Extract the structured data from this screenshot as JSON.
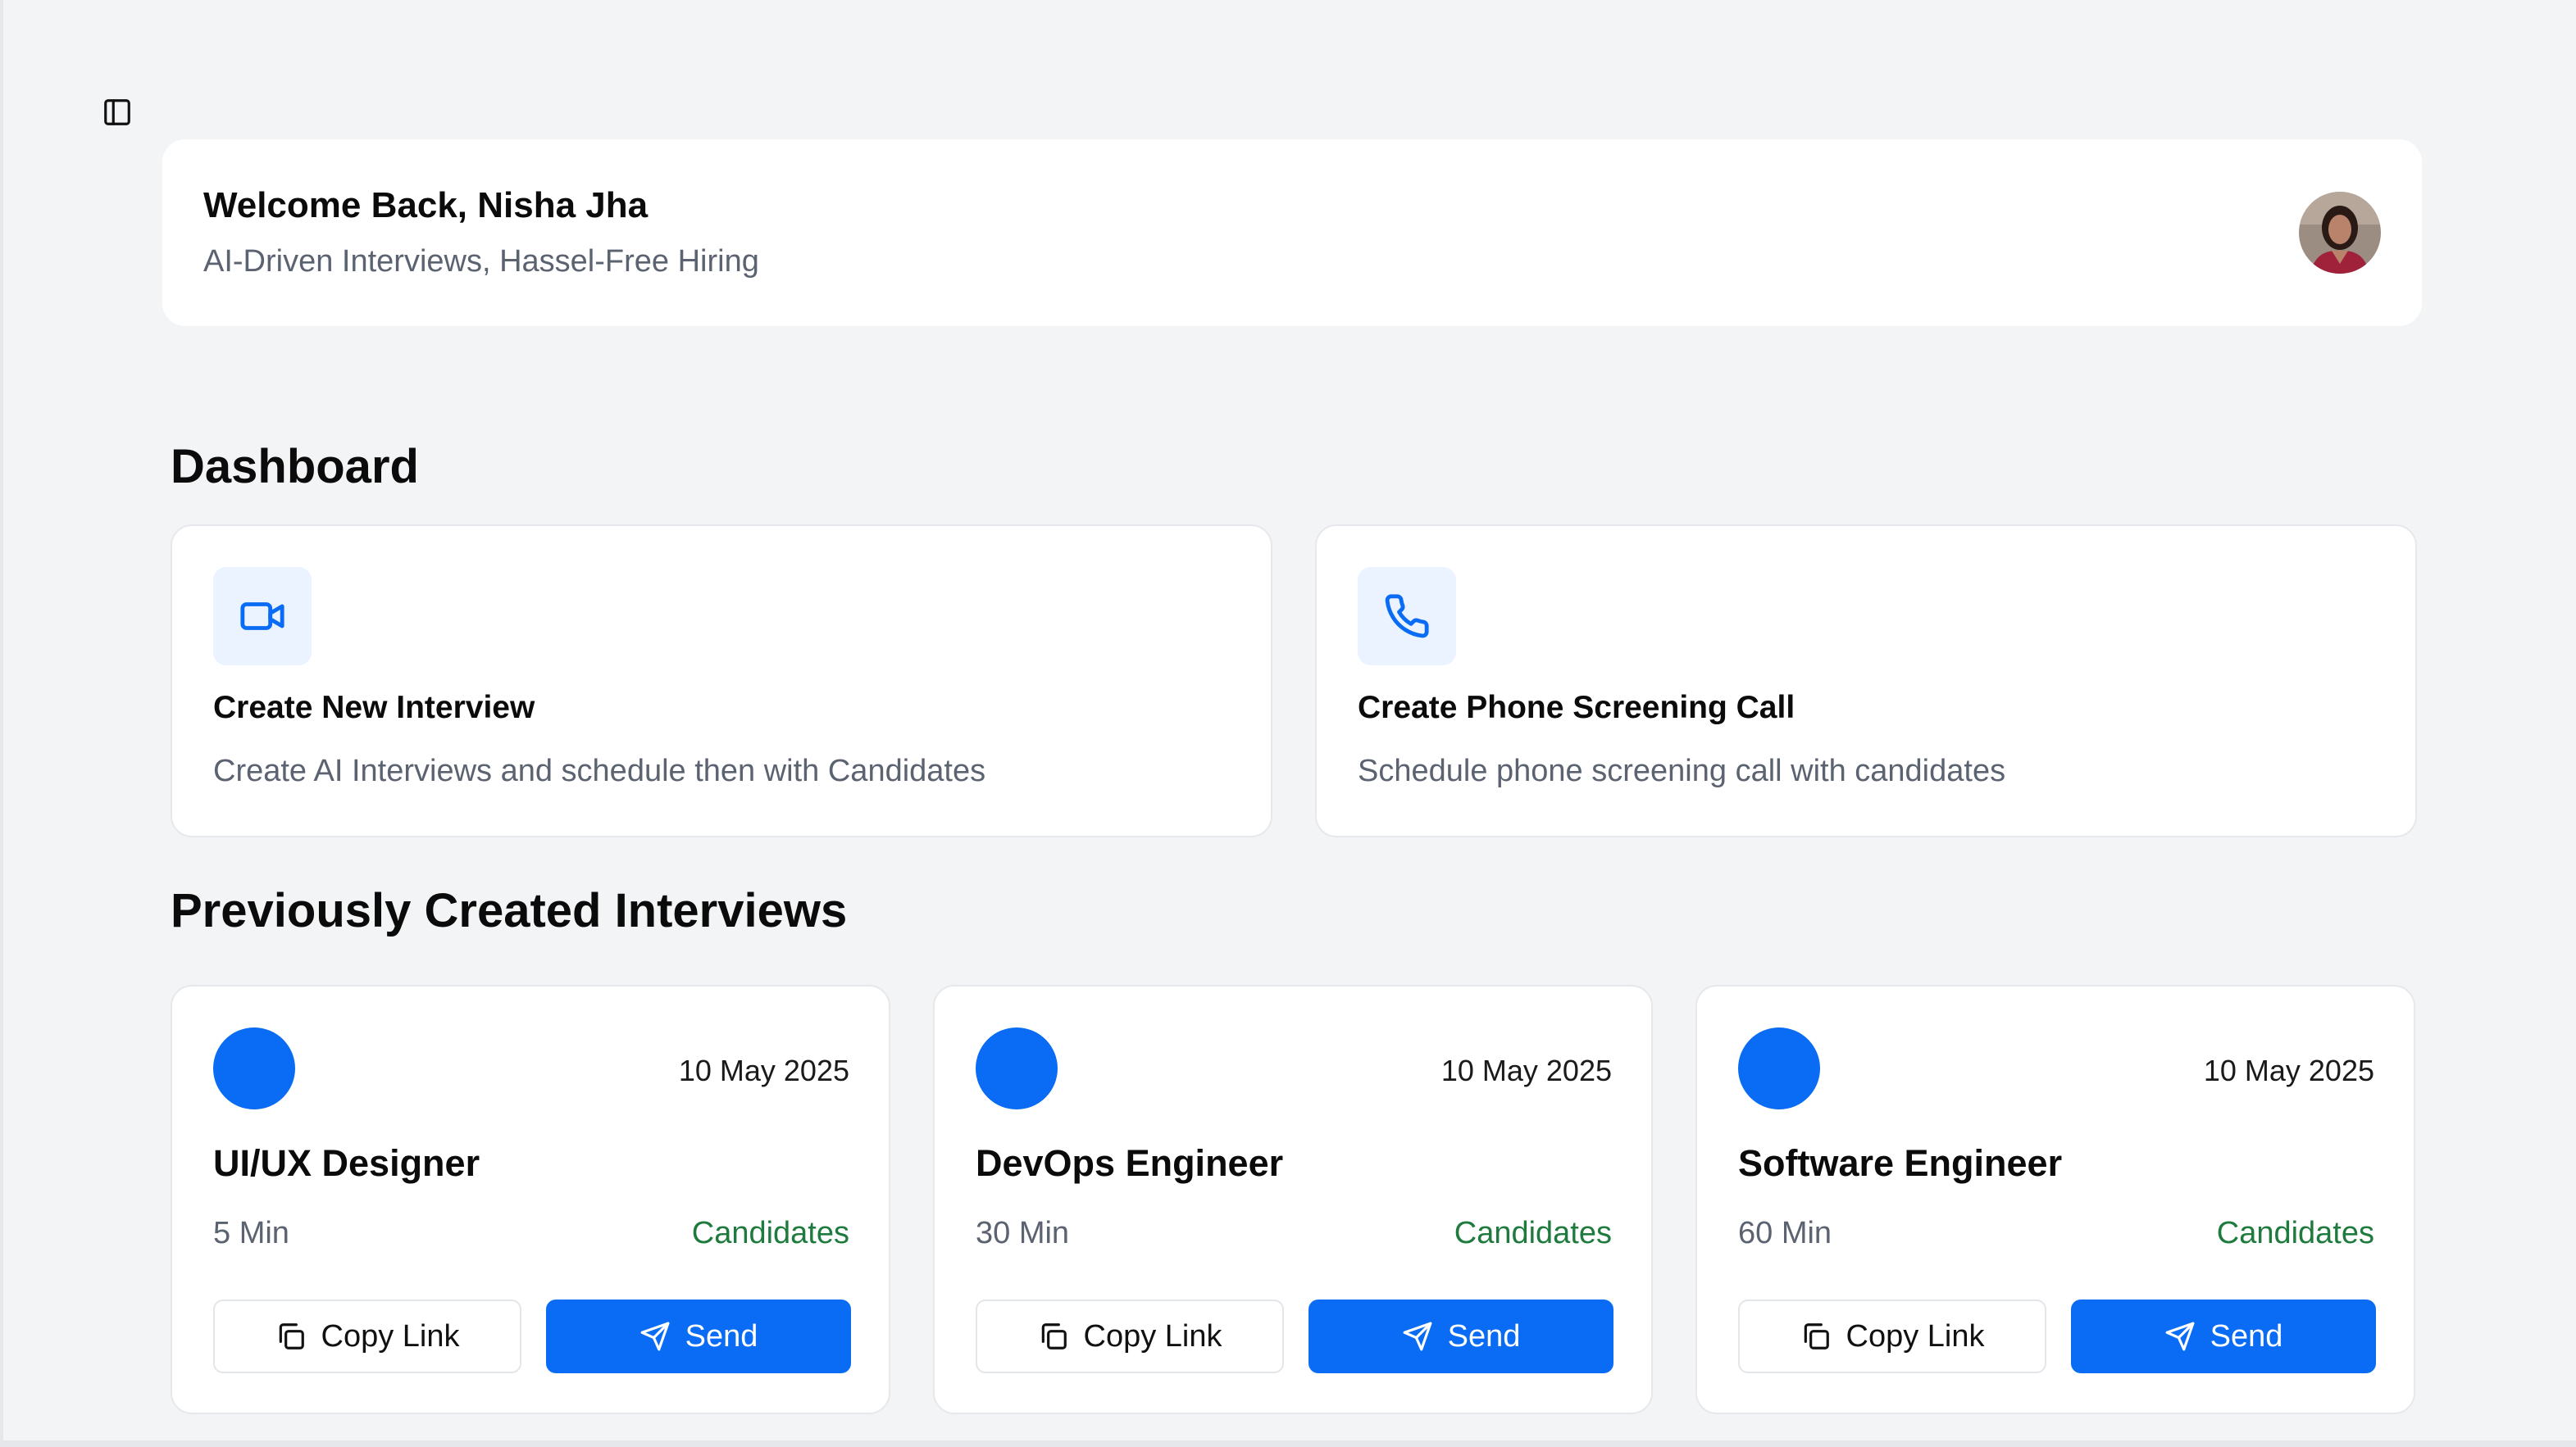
{
  "header": {
    "welcome_title": "Welcome Back, Nisha Jha",
    "welcome_subtitle": "AI-Driven Interviews, Hassel-Free Hiring"
  },
  "dashboard": {
    "title": "Dashboard",
    "actions": [
      {
        "icon": "video-camera-icon",
        "title": "Create New Interview",
        "description": "Create AI Interviews and schedule then with Candidates"
      },
      {
        "icon": "phone-icon",
        "title": "Create Phone Screening Call",
        "description": "Schedule phone screening call with candidates"
      }
    ]
  },
  "previous": {
    "title": "Previously Created Interviews",
    "interviews": [
      {
        "date": "10 May 2025",
        "role": "UI/UX Designer",
        "duration": "5 Min",
        "candidates_label": "Candidates",
        "copy_label": "Copy Link",
        "send_label": "Send"
      },
      {
        "date": "10 May 2025",
        "role": "DevOps Engineer",
        "duration": "30 Min",
        "candidates_label": "Candidates",
        "copy_label": "Copy Link",
        "send_label": "Send"
      },
      {
        "date": "10 May 2025",
        "role": "Software Engineer",
        "duration": "60 Min",
        "candidates_label": "Candidates",
        "copy_label": "Copy Link",
        "send_label": "Send"
      }
    ]
  },
  "colors": {
    "accent": "#0a6cf5",
    "candidates_link": "#1f7a3e",
    "background": "#f3f4f6",
    "icon_tile": "#eaf3ff"
  }
}
